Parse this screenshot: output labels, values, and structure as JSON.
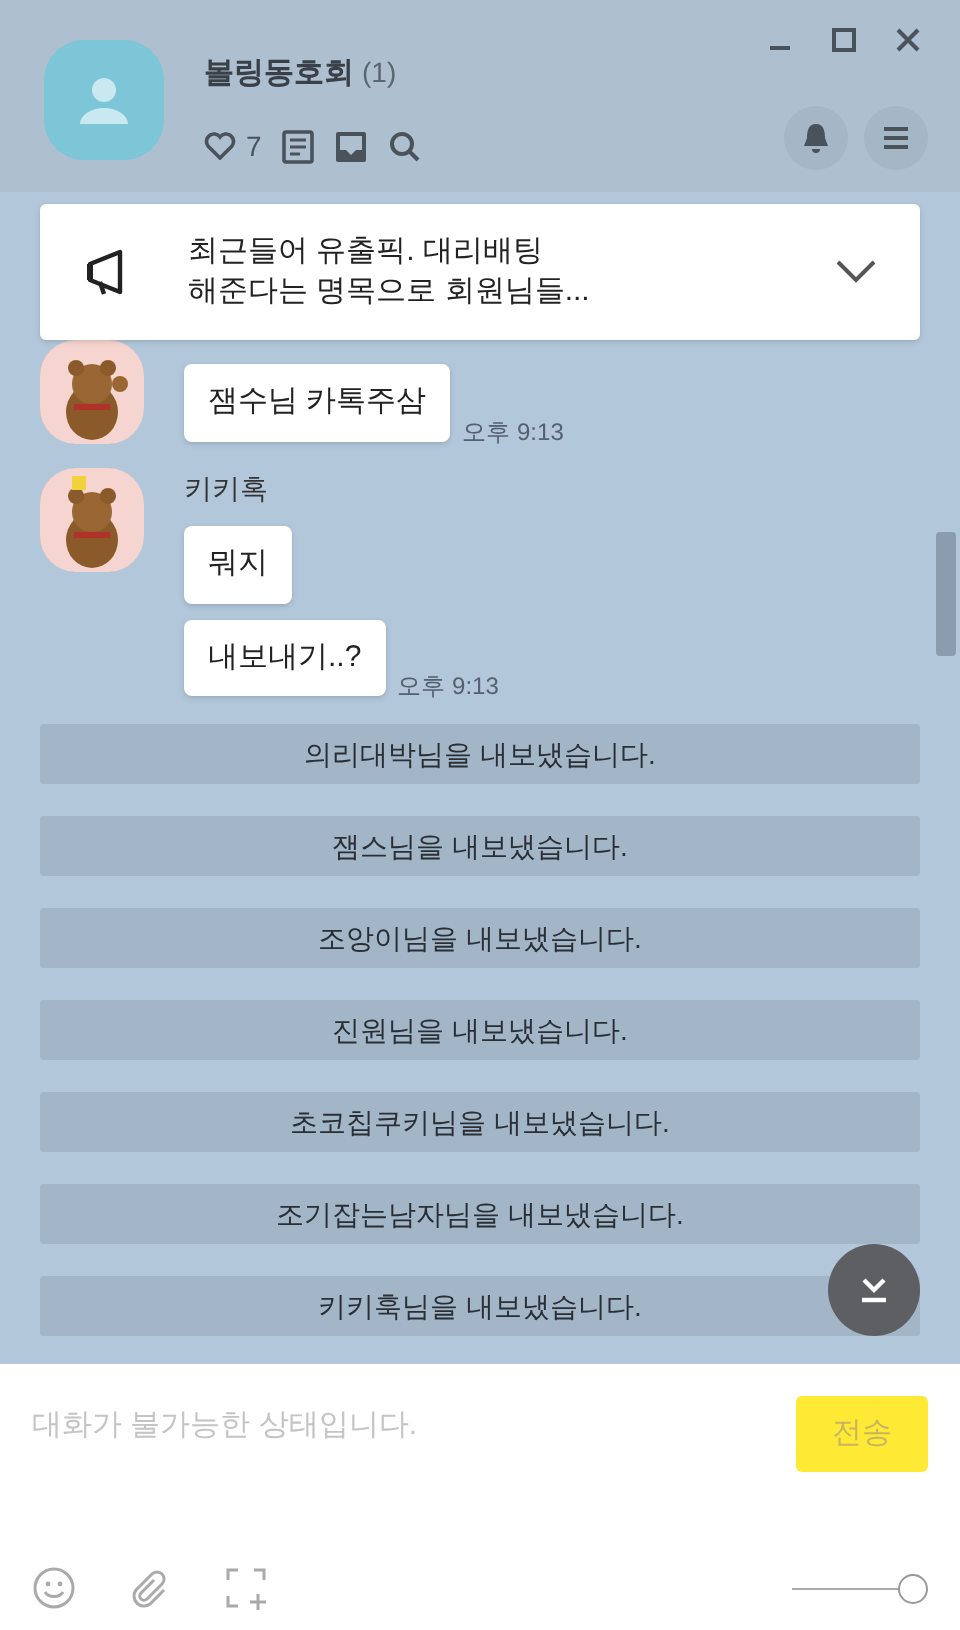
{
  "header": {
    "title": "볼링동호회",
    "member_count": "(1)",
    "likes": "7"
  },
  "notice": {
    "text": "최근들어 유출픽. 대리배팅\n해준다는 명목으로 회원님들..."
  },
  "messages": [
    {
      "bubbles": [
        "잼수님 카톡주삼"
      ],
      "time": "오후 9:13"
    },
    {
      "sender": "키키혹",
      "bubbles": [
        "뭐지",
        "내보내기..?"
      ],
      "time": "오후 9:13"
    }
  ],
  "system_messages": [
    "의리대박님을 내보냈습니다.",
    "잼스님을 내보냈습니다.",
    "조앙이님을 내보냈습니다.",
    "진원님을 내보냈습니다.",
    "초코칩쿠키님을 내보냈습니다.",
    "조기잡는남자님을 내보냈습니다.",
    "키키훅님을 내보냈습니다."
  ],
  "input": {
    "placeholder": "대화가 불가능한 상태입니다.",
    "send_label": "전송"
  },
  "opacity_slider": {
    "level": 1
  }
}
